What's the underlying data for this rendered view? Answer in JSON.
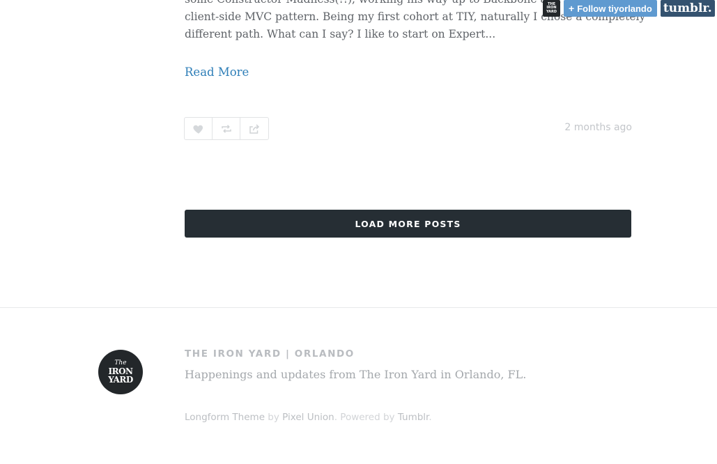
{
  "post": {
    "excerpt_lines": [
      "some Constructor Madness(!!), working his way up to Backbone and",
      "client-side MVC pattern. Being my first cohort at TIY, naturally I chose a completely",
      "different path. What can I say? I like to start on Expert..."
    ],
    "read_more": "Read More",
    "timestamp": "2 months ago",
    "actions": [
      {
        "icon": "heart-icon"
      },
      {
        "icon": "reblog-icon"
      },
      {
        "icon": "share-icon"
      }
    ]
  },
  "load_more": {
    "label": "LOAD MORE POSTS"
  },
  "footer": {
    "logo": {
      "line1": "The",
      "line2": "IRON",
      "line3": "YARD"
    },
    "title": "THE IRON YARD | ORLANDO",
    "description": "Happenings and updates from The Iron Yard in Orlando, FL.",
    "credits": {
      "theme": "Longform Theme",
      "by": " by ",
      "author": "Pixel Union",
      "powered": ". Powered by ",
      "platform": "Tumblr",
      "end": "."
    }
  },
  "tumblr_bar": {
    "avatar": {
      "line1": "THE",
      "line2": "IRON",
      "line3": "YARD"
    },
    "follow_plus": "+",
    "follow_label": "Follow tiyorlando",
    "brand": "tumblr."
  },
  "colors": {
    "link": "#2f7fb8",
    "button_dark": "#262e34",
    "follow_blue": "#5f9ad0",
    "tumblr_blue": "#34526f"
  }
}
